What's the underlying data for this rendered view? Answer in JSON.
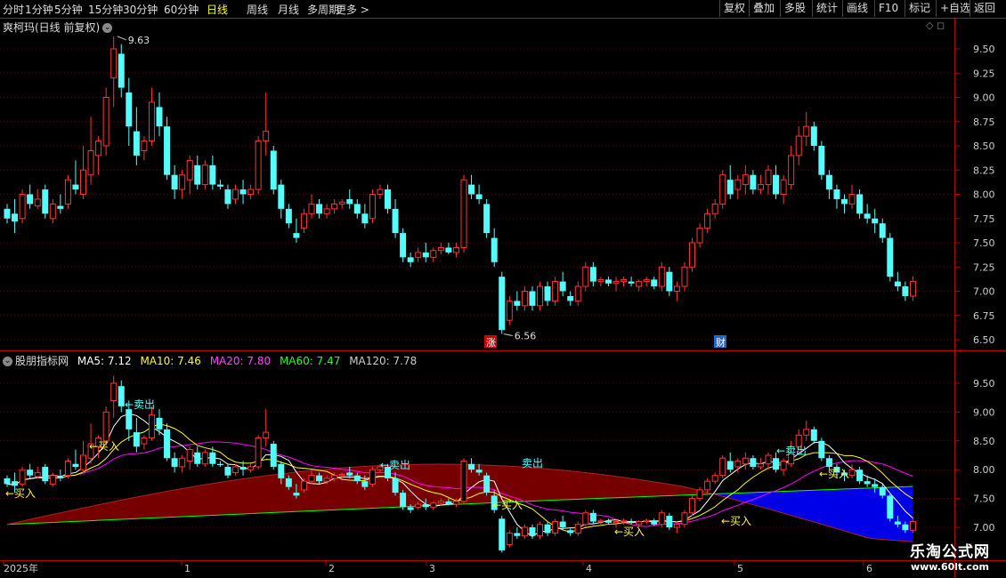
{
  "topbar": {
    "periods": [
      "分时",
      "1分钟",
      "5分钟",
      "15分钟",
      "30分钟",
      "60分钟",
      "日线",
      "周线",
      "月线",
      "多周期",
      "更多 >"
    ],
    "active_period": "日线",
    "buttons": [
      "复权",
      "叠加",
      "多股",
      "统计",
      "画线",
      "F10",
      "标记",
      "+自选",
      "返回"
    ]
  },
  "main_panel": {
    "title": "爽柯玛(日线 前复权)",
    "y_ticks": [
      "9.50",
      "9.25",
      "9.00",
      "8.75",
      "8.50",
      "8.25",
      "8.00",
      "7.75",
      "7.50",
      "7.25",
      "7.00",
      "6.75",
      "6.50"
    ],
    "high_label": "9.63",
    "low_label": "6.56",
    "event_zhang": "涨",
    "event_cai": "财"
  },
  "indicator_panel": {
    "name": "股朋指标网",
    "ma5": "MA5: 7.12",
    "ma10": "MA10: 7.46",
    "ma20": "MA20: 7.80",
    "ma60": "MA60: 7.47",
    "ma120": "MA120: 7.78",
    "y_ticks": [
      "9.50",
      "9.00",
      "8.50",
      "8.00",
      "7.50",
      "7.00"
    ],
    "buy_label": "←买入",
    "sell_label": "←卖出",
    "sell_label_plain": "卖出"
  },
  "x_axis": {
    "labels": [
      "2025年",
      "1",
      "2",
      "3",
      "4",
      "5",
      "6"
    ]
  },
  "colors": {
    "up": "#ff3333",
    "down": "#54fcfc",
    "ma5": "#ffffff",
    "ma10": "#ffff00",
    "ma20": "#ff00ff",
    "ma60": "#00ff00",
    "ma120": "#cccccc",
    "band_red": "#8b0000",
    "band_blue": "#0000ff"
  },
  "watermark": {
    "line1": "乐淘公式网",
    "line2": "www.60lt.com"
  }
}
